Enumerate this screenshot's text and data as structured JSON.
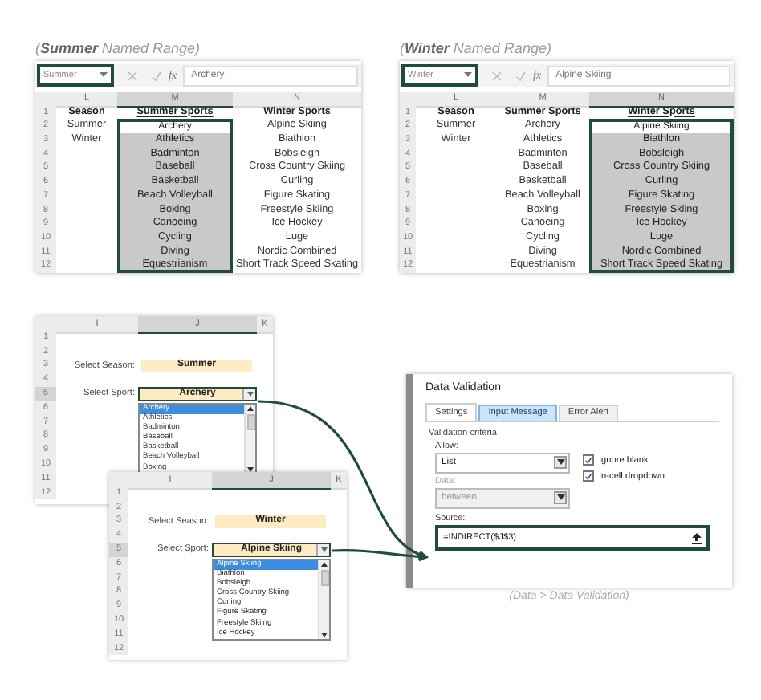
{
  "named_range_views": [
    {
      "caption": "(**Summer** Named Range)",
      "name_box": "Summer",
      "function_label": "fx",
      "formula": "Archery",
      "columns": [
        {
          "label": "L",
          "selected": false
        },
        {
          "label": "M",
          "selected": true
        },
        {
          "label": "N",
          "selected": false
        }
      ],
      "rows": [
        {
          "number": "1",
          "kind": "header",
          "season": "Season",
          "summer_sport": "Summer Sports",
          "winter_sport": "Winter Sports"
        },
        {
          "number": "2",
          "kind": "data",
          "season": "Summer",
          "summer_sport": "Archery",
          "winter_sport": "Alpine Skiing"
        },
        {
          "number": "3",
          "kind": "data",
          "season": "Winter",
          "summer_sport": "Athletics",
          "winter_sport": "Biathlon"
        },
        {
          "number": "4",
          "kind": "data",
          "summer_sport": "Badminton",
          "winter_sport": "Bobsleigh"
        },
        {
          "number": "5",
          "kind": "data",
          "summer_sport": "Baseball",
          "winter_sport": "Cross Country Skiing"
        },
        {
          "number": "6",
          "kind": "data",
          "summer_sport": "Basketball",
          "winter_sport": "Curling"
        },
        {
          "number": "7",
          "kind": "data",
          "summer_sport": "Beach Volleyball",
          "winter_sport": "Figure Skating"
        },
        {
          "number": "8",
          "kind": "data",
          "summer_sport": "Boxing",
          "winter_sport": "Freestyle Skiing"
        },
        {
          "number": "9",
          "kind": "data",
          "summer_sport": "Canoeing",
          "winter_sport": "Ice Hockey"
        },
        {
          "number": "10",
          "kind": "data",
          "summer_sport": "Cycling",
          "winter_sport": "Luge"
        },
        {
          "number": "11",
          "kind": "data",
          "summer_sport": "Diving",
          "winter_sport": "Nordic Combined"
        },
        {
          "number": "12",
          "kind": "data",
          "summer_sport": "Equestrianism",
          "winter_sport": "Short Track Speed Skating"
        }
      ]
    },
    {
      "caption": "(**Winter** Named Range)",
      "name_box": "Winter",
      "function_label": "fx",
      "formula": "Alpine Skiing",
      "columns": [
        {
          "label": "L",
          "selected": false
        },
        {
          "label": "M",
          "selected": false
        },
        {
          "label": "N",
          "selected": true
        }
      ],
      "rows": [
        {
          "number": "1",
          "kind": "header",
          "season": "Season",
          "summer_sport": "Summer Sports",
          "winter_sport": "Winter Sports"
        },
        {
          "number": "2",
          "kind": "data",
          "season": "Summer",
          "summer_sport": "Archery",
          "winter_sport": "Alpine Skiing"
        },
        {
          "number": "3",
          "kind": "data",
          "season": "Winter",
          "summer_sport": "Athletics",
          "winter_sport": "Biathlon"
        },
        {
          "number": "4",
          "kind": "data",
          "summer_sport": "Badminton",
          "winter_sport": "Bobsleigh"
        },
        {
          "number": "5",
          "kind": "data",
          "summer_sport": "Baseball",
          "winter_sport": "Cross Country Skiing"
        },
        {
          "number": "6",
          "kind": "data",
          "summer_sport": "Basketball",
          "winter_sport": "Curling"
        },
        {
          "number": "7",
          "kind": "data",
          "summer_sport": "Beach Volleyball",
          "winter_sport": "Figure Skating"
        },
        {
          "number": "8",
          "kind": "data",
          "summer_sport": "Boxing",
          "winter_sport": "Freestyle Skiing"
        },
        {
          "number": "9",
          "kind": "data",
          "summer_sport": "Canoeing",
          "winter_sport": "Ice Hockey"
        },
        {
          "number": "10",
          "kind": "data",
          "summer_sport": "Cycling",
          "winter_sport": "Luge"
        },
        {
          "number": "11",
          "kind": "data",
          "summer_sport": "Diving",
          "winter_sport": "Nordic Combined"
        },
        {
          "number": "12",
          "kind": "data",
          "summer_sport": "Equestrianism",
          "winter_sport": "Short Track Speed Skating"
        }
      ]
    }
  ],
  "dropdown_examples": [
    {
      "columns": [
        {
          "label": "I",
          "selected": false
        },
        {
          "label": "J",
          "selected": true
        },
        {
          "label": "K",
          "selected": false
        }
      ],
      "rows": [
        {
          "number": "1",
          "selected": false,
          "kind": "blank"
        },
        {
          "number": "2",
          "selected": false,
          "kind": "blank"
        },
        {
          "number": "3",
          "selected": false,
          "kind": "field",
          "label": "Select Season:",
          "value": "Summer"
        },
        {
          "number": "4",
          "selected": false,
          "kind": "blank"
        },
        {
          "number": "5",
          "selected": true,
          "kind": "dropdown",
          "label": "Select Sport:",
          "value": "Archery"
        },
        {
          "number": "6",
          "selected": false,
          "kind": "blank"
        },
        {
          "number": "7",
          "selected": false,
          "kind": "blank"
        },
        {
          "number": "8",
          "selected": false,
          "kind": "blank"
        },
        {
          "number": "9",
          "selected": false,
          "kind": "blank"
        },
        {
          "number": "10",
          "selected": false,
          "kind": "blank"
        },
        {
          "number": "11",
          "selected": false,
          "kind": "blank"
        },
        {
          "number": "12",
          "selected": false,
          "kind": "blank"
        }
      ],
      "list": [
        {
          "label": "Archery",
          "selected": true
        },
        {
          "label": "Athletics",
          "selected": false
        },
        {
          "label": "Badminton",
          "selected": false
        },
        {
          "label": "Baseball",
          "selected": false
        },
        {
          "label": "Basketball",
          "selected": false
        },
        {
          "label": "Beach Volleyball",
          "selected": false
        },
        {
          "label": "Boxing",
          "selected": false
        }
      ]
    },
    {
      "columns": [
        {
          "label": "I",
          "selected": false
        },
        {
          "label": "J",
          "selected": true
        },
        {
          "label": "K",
          "selected": false
        }
      ],
      "rows": [
        {
          "number": "1",
          "selected": false,
          "kind": "blank"
        },
        {
          "number": "2",
          "selected": false,
          "kind": "blank"
        },
        {
          "number": "3",
          "selected": false,
          "kind": "field",
          "label": "Select Season:",
          "value": "Winter"
        },
        {
          "number": "4",
          "selected": false,
          "kind": "blank"
        },
        {
          "number": "5",
          "selected": true,
          "kind": "dropdown",
          "label": "Select Sport:",
          "value": "Alpine Skiing"
        },
        {
          "number": "6",
          "selected": false,
          "kind": "blank"
        },
        {
          "number": "7",
          "selected": false,
          "kind": "blank"
        },
        {
          "number": "8",
          "selected": false,
          "kind": "blank"
        },
        {
          "number": "9",
          "selected": false,
          "kind": "blank"
        },
        {
          "number": "10",
          "selected": false,
          "kind": "blank"
        },
        {
          "number": "11",
          "selected": false,
          "kind": "blank"
        },
        {
          "number": "12",
          "selected": false,
          "kind": "blank"
        }
      ],
      "list": [
        {
          "label": "Alpine Skiing",
          "selected": true
        },
        {
          "label": "Biathlon",
          "selected": false
        },
        {
          "label": "Bobsleigh",
          "selected": false
        },
        {
          "label": "Cross Country Skiing",
          "selected": false
        },
        {
          "label": "Curling",
          "selected": false
        },
        {
          "label": "Figure Skating",
          "selected": false
        },
        {
          "label": "Freestyle Skiing",
          "selected": false
        },
        {
          "label": "Ice Hockey",
          "selected": false
        }
      ]
    }
  ],
  "data_validation": {
    "title": "Data Validation",
    "tabs": [
      {
        "label": "Settings",
        "selected": true,
        "hovered": false
      },
      {
        "label": "Input Message",
        "selected": false,
        "hovered": true
      },
      {
        "label": "Error Alert",
        "selected": false,
        "hovered": false
      }
    ],
    "group_title": "Validation criteria",
    "allow": {
      "label": "Allow:",
      "value": "List",
      "disabled": false
    },
    "data": {
      "label": "Data:",
      "value": "between",
      "disabled": true
    },
    "checkboxes": [
      {
        "label": "Ignore blank",
        "checked": true
      },
      {
        "label": "In-cell dropdown",
        "checked": true
      }
    ],
    "source": {
      "label": "Source:",
      "value": "=INDIRECT($J$3)"
    },
    "caption": "(Data > Data Validation)"
  }
}
